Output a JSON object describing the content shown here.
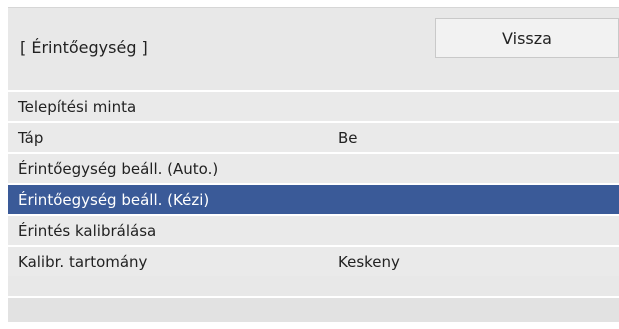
{
  "header": {
    "title": "[ Érintőegység ]",
    "back_label": "Vissza"
  },
  "menu": {
    "items": [
      {
        "label": "Telepítési minta",
        "value": "",
        "selected": false
      },
      {
        "label": "Táp",
        "value": "Be",
        "selected": false
      },
      {
        "label": "Érintőegység beáll. (Auto.)",
        "value": "",
        "selected": false
      },
      {
        "label": "Érintőegység beáll. (Kézi)",
        "value": "",
        "selected": true
      },
      {
        "label": "Érintés kalibrálása",
        "value": "",
        "selected": false
      },
      {
        "label": "Kalibr. tartomány",
        "value": "Keskeny",
        "selected": false
      }
    ]
  },
  "colors": {
    "selection": "#3a5a98",
    "background": "#e8e8e8"
  }
}
